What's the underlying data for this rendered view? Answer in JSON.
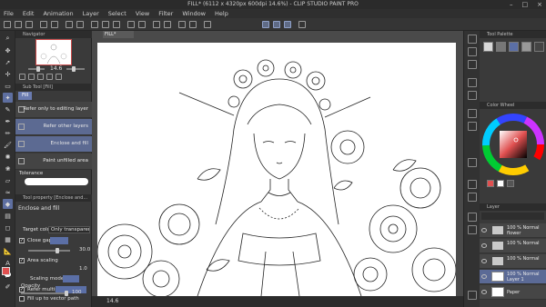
{
  "window": {
    "title": "FILL* (6112 x 4320px 600dpi 14.6%)  - CLIP STUDIO PAINT PRO"
  },
  "menu": [
    "File",
    "Edit",
    "Animation",
    "Layer",
    "Select",
    "View",
    "Filter",
    "Window",
    "Help"
  ],
  "navigator": {
    "title": "Navigator",
    "zoom": "14.6"
  },
  "subtool": {
    "title": "Sub Tool [Fill]",
    "active_tab": "Fill",
    "items": [
      {
        "label": "Refer only to editing layer"
      },
      {
        "label": "Refer other layers"
      },
      {
        "label": "Enclose and fill"
      },
      {
        "label": "Paint unfilled area"
      }
    ],
    "tolerance_label": "Tolerance"
  },
  "tool_property": {
    "title": "Tool property [Enclose and...",
    "tool_name": "Enclose and fill",
    "target_color_label": "Target color",
    "target_color_value": "Only transparent",
    "close_gap_label": "Close gap",
    "close_gap_value": "30.0",
    "area_scaling_label": "Area scaling",
    "area_scaling_value": "1.0",
    "scaling_mode_label": "Scaling mode",
    "refer_multiple_label": "Refer multiple",
    "fill_vector_label": "Fill up to vector path",
    "opacity_label": "Opacity",
    "opacity_value": "100"
  },
  "canvas": {
    "tab": "FILL*",
    "zoom": "14.6"
  },
  "right": {
    "palette_title": "Tool Palette",
    "color_wheel_title": "Color Wheel",
    "layer_title": "Layer",
    "layers": [
      {
        "name": "100 % Normal",
        "sub": "flower"
      },
      {
        "name": "100 % Normal",
        "sub": ""
      },
      {
        "name": "100 % Normal",
        "sub": ""
      },
      {
        "name": "100 % Normal",
        "sub": "Layer 1"
      },
      {
        "name": "Paper",
        "sub": ""
      }
    ]
  },
  "colors": {
    "accent": "#5e6fa0",
    "main_color": "#e05050",
    "sub_color": "#ffffff"
  }
}
